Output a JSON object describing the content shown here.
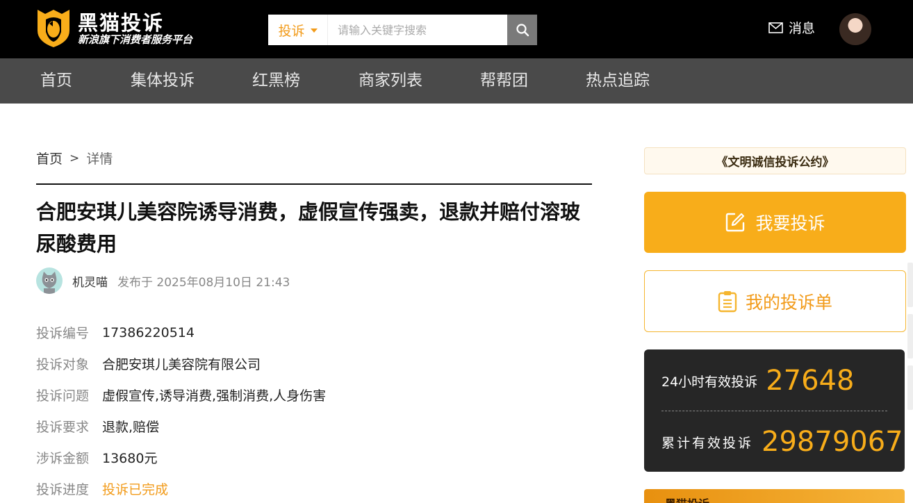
{
  "header": {
    "logo_title": "黑猫投诉",
    "logo_subtitle": "新浪旗下消费者服务平台",
    "search": {
      "type_label": "投诉",
      "placeholder": "请输入关键字搜索"
    },
    "message_label": "消息"
  },
  "nav": {
    "items": [
      "首页",
      "集体投诉",
      "红黑榜",
      "商家列表",
      "帮帮团",
      "热点追踪"
    ]
  },
  "breadcrumb": {
    "home": "首页",
    "separator": ">",
    "current": "详情"
  },
  "complaint": {
    "title": "合肥安琪儿美容院诱导消费，虚假宣传强卖，退款并赔付溶玻尿酸费用",
    "author": "机灵喵",
    "published": "发布于 2025年08月10日 21:43",
    "fields": [
      {
        "label": "投诉编号",
        "value": "17386220514"
      },
      {
        "label": "投诉对象",
        "value": "合肥安琪儿美容院有限公司"
      },
      {
        "label": "投诉问题",
        "value": "虚假宣传,诱导消费,强制消费,人身伤害"
      },
      {
        "label": "投诉要求",
        "value": "退款,赔偿"
      },
      {
        "label": "涉诉金额",
        "value": "13680元"
      },
      {
        "label": "投诉进度",
        "value": "投诉已完成"
      }
    ]
  },
  "sidebar": {
    "pact_label": "《文明诚信投诉公约》",
    "complain_button": "我要投诉",
    "my_list_button": "我的投诉单",
    "stats": {
      "day_label": "24小时有效投诉",
      "day_value": "27648",
      "total_label": "累计有效投诉",
      "total_value": "29879067"
    },
    "banner_text": "黑猫投诉"
  },
  "colors": {
    "brand_orange": "#f8ad1a",
    "status_orange": "#f29b1a",
    "header_bg": "#000000",
    "nav_bg": "#4a4a4a",
    "stats_bg": "#262626"
  },
  "icons": {
    "logo": "cat-shield-icon",
    "search": "search-icon",
    "message": "mail-icon",
    "complain": "edit-icon",
    "my_list": "clipboard-icon"
  }
}
